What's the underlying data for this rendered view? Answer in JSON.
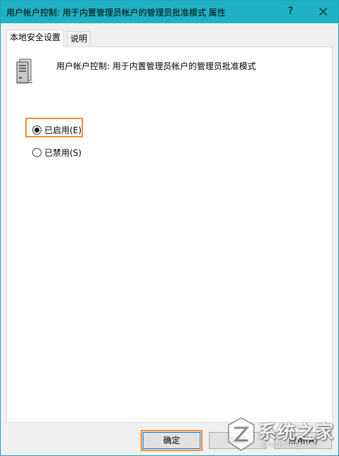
{
  "window": {
    "title": "用户帐户控制: 用于内置管理员帐户的管理员批准模式 属性",
    "help_label": "?",
    "accent_color": "#1fb1c3"
  },
  "tabs": [
    {
      "label": "本地安全设置",
      "active": true
    },
    {
      "label": "说明",
      "active": false
    }
  ],
  "policy": {
    "icon": "server-policy-icon",
    "title": "用户帐户控制: 用于内置管理员帐户的管理员批准模式"
  },
  "options": [
    {
      "label": "已启用(E)",
      "checked": true
    },
    {
      "label": "已禁用(S)",
      "checked": false
    }
  ],
  "buttons": {
    "ok": "确定",
    "cancel": "取消",
    "apply": "应用(A)"
  },
  "highlight_color": "#f08a35",
  "watermark": {
    "text": "系统之家",
    "sub": "XITONGZHIJIA.NET"
  }
}
